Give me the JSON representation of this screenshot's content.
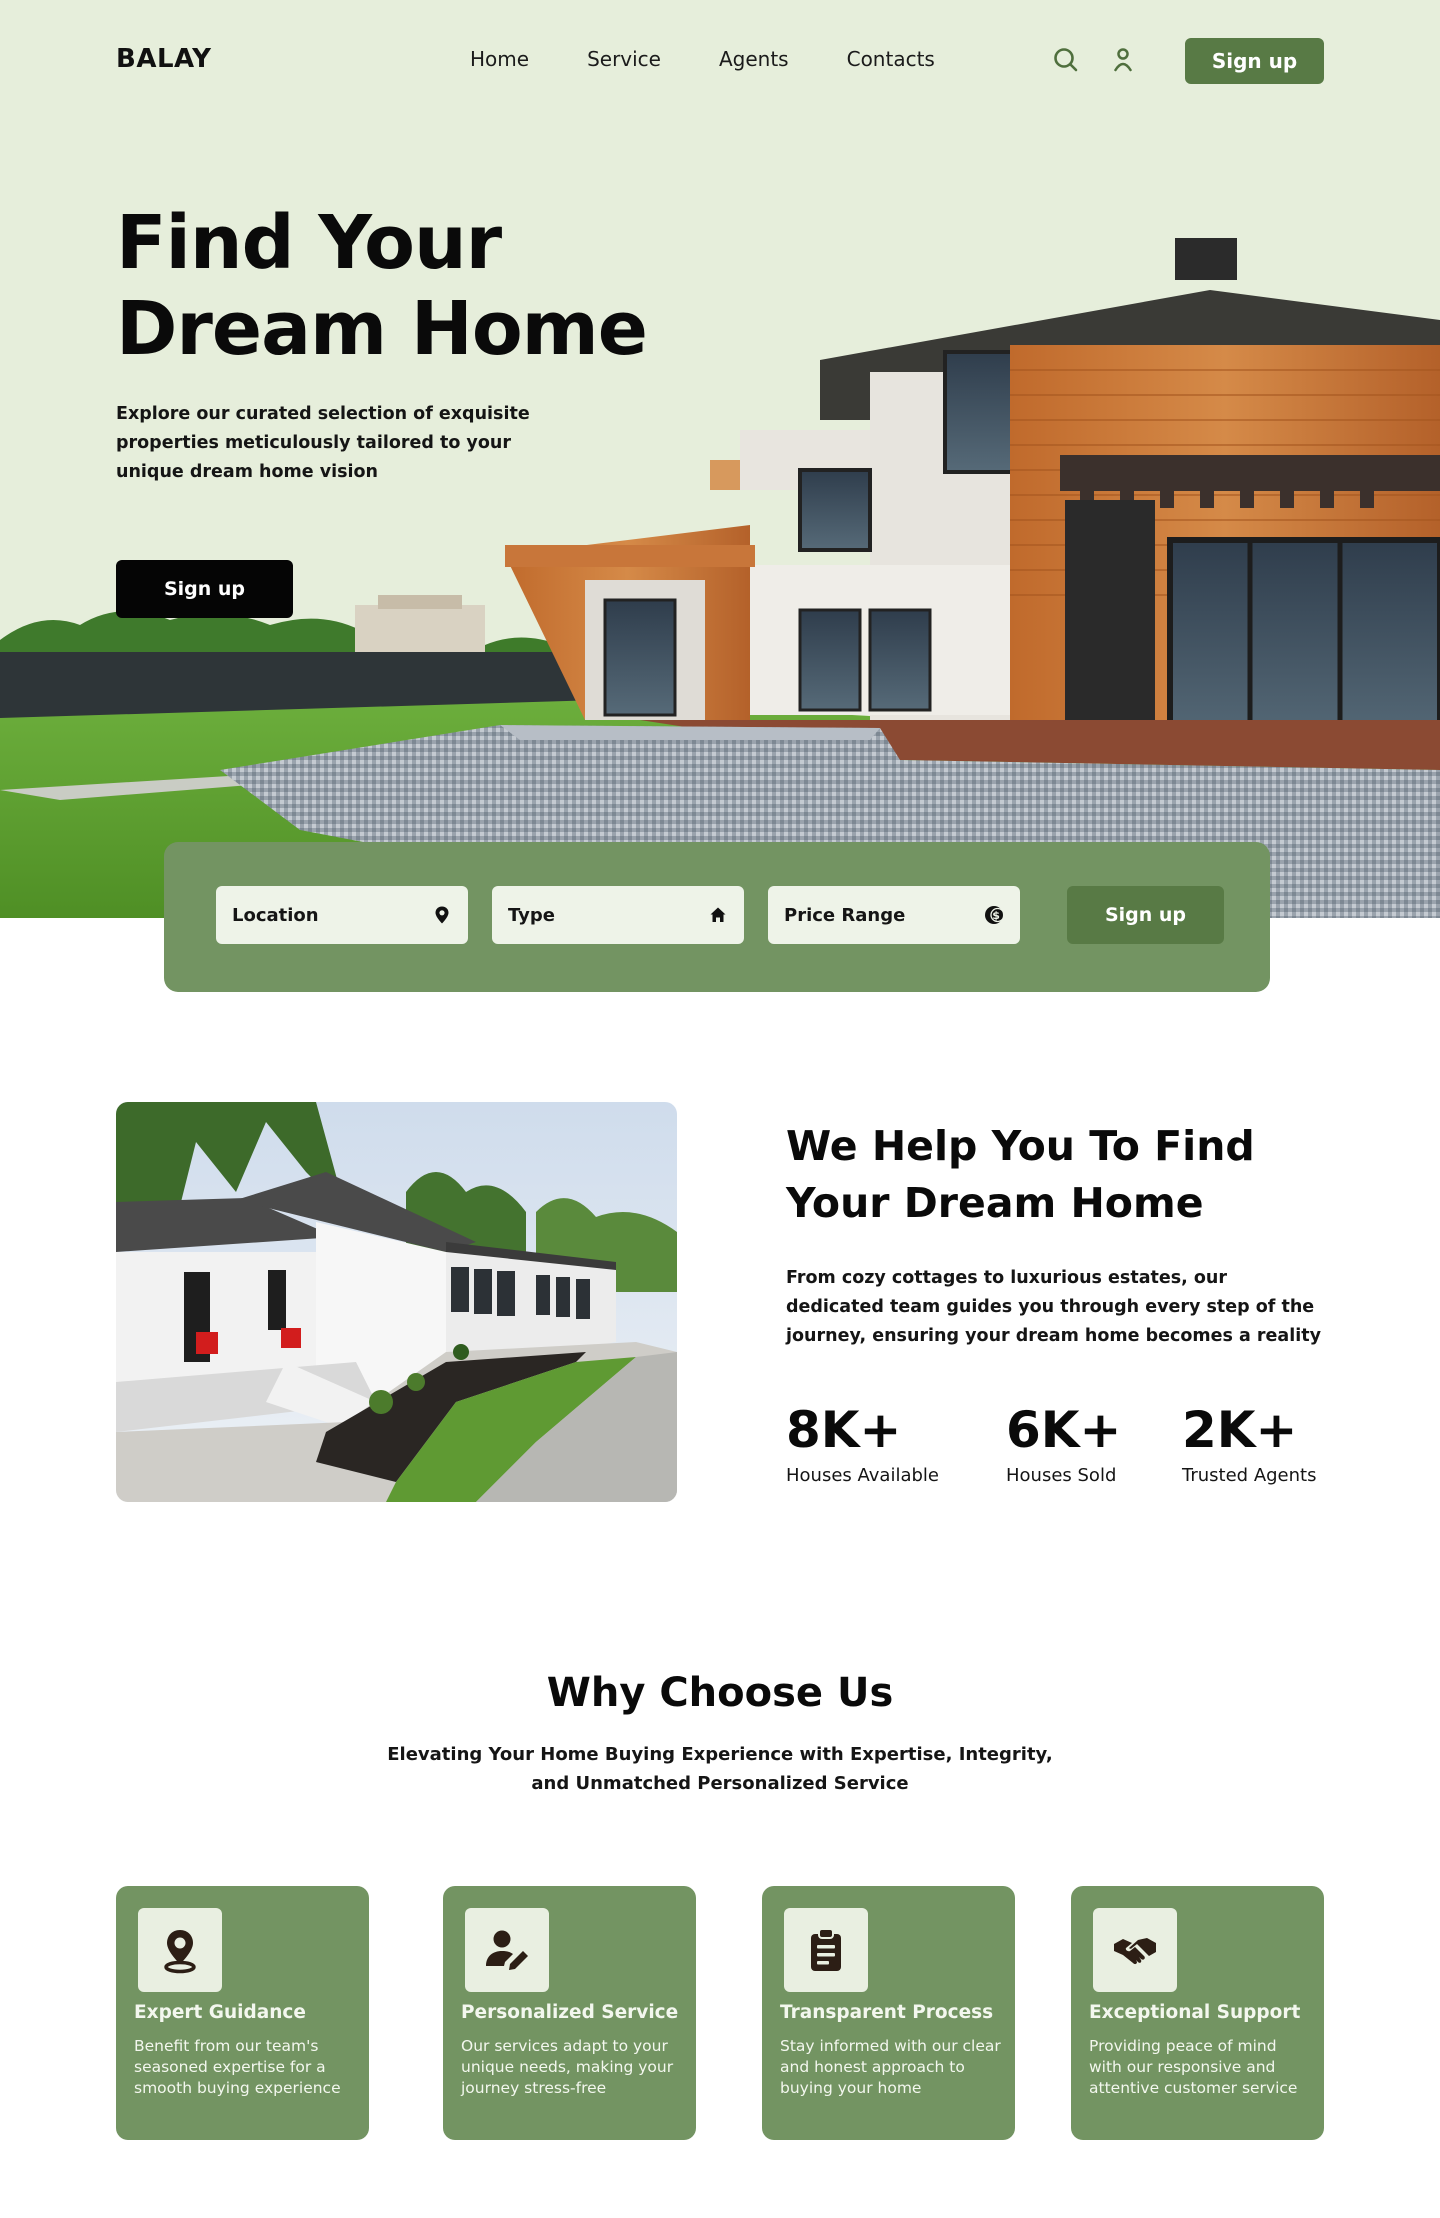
{
  "nav": {
    "logo": "BALAY",
    "links": [
      "Home",
      "Service",
      "Agents",
      "Contacts"
    ],
    "icons": [
      "search-icon",
      "user-icon"
    ],
    "signup_label": "Sign up"
  },
  "hero": {
    "title_line1": "Find Your",
    "title_line2": "Dream Home",
    "subtitle": "Explore our curated selection of exquisite properties meticulously tailored to your unique dream home vision",
    "cta_label": "Sign up"
  },
  "search": {
    "location_label": "Location",
    "type_label": "Type",
    "price_label": "Price Range",
    "button_label": "Sign up",
    "icons": [
      "location-pin-icon",
      "house-icon",
      "dollar-coin-icon"
    ]
  },
  "about": {
    "title_line1": "We Help You To Find",
    "title_line2": "Your Dream Home",
    "text": "From cozy cottages to luxurious estates, our dedicated team guides you through every step of the journey, ensuring your dream home becomes a reality",
    "stats": [
      {
        "value": "8K+",
        "label": "Houses Available"
      },
      {
        "value": "6K+",
        "label": "Houses Sold"
      },
      {
        "value": "2K+",
        "label": "Trusted Agents"
      }
    ]
  },
  "why": {
    "title": "Why Choose Us",
    "subtitle": "Elevating Your Home Buying Experience with Expertise, Integrity, and Unmatched Personalized Service",
    "cards": [
      {
        "icon": "map-pin-icon",
        "title": "Expert Guidance",
        "text": "Benefit from our team's seasoned expertise for a smooth buying experience"
      },
      {
        "icon": "user-edit-icon",
        "title": "Personalized Service",
        "text": "Our services adapt to your unique needs, making your journey stress-free"
      },
      {
        "icon": "clipboard-icon",
        "title": "Transparent Process",
        "text": "Stay informed with our clear and honest approach to buying your home"
      },
      {
        "icon": "handshake-icon",
        "title": "Exceptional Support",
        "text": "Providing peace of mind with our responsive and attentive customer service"
      }
    ]
  },
  "colors": {
    "hero_bg": "#e6eedb",
    "brand_green": "#587a45",
    "panel_green": "#739462",
    "dark": "#0a0a0a"
  }
}
